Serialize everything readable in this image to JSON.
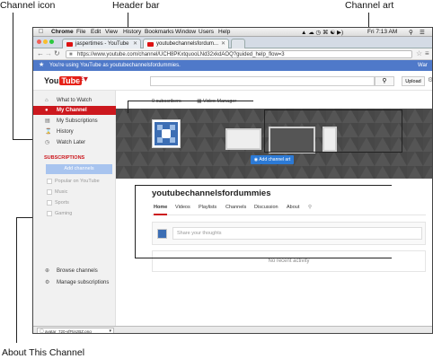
{
  "callouts": {
    "channel_icon": "Channel icon",
    "header_bar": "Header bar",
    "channel_art": "Channel art",
    "about_channel": "About This Channel"
  },
  "mac_menu": {
    "app": "Chrome",
    "items": [
      "File",
      "Edit",
      "View",
      "History",
      "Bookmarks",
      "Window",
      "Users",
      "Help"
    ],
    "clock": "Fri 7:13 AM"
  },
  "browser": {
    "tabs": [
      {
        "label": "jaspertimes - YouTube",
        "active": false
      },
      {
        "label": "youtubechannelsfordum...",
        "active": true
      }
    ],
    "url": "https://www.youtube.com/channel/UCH8PKxtquooLNd32xkdAOQ?guided_help_flow=3",
    "notice": "You're using YouTube as youtubechannelsfordummies.",
    "notice_right": "War"
  },
  "youtube": {
    "logo_you": "You",
    "logo_tube": "Tube",
    "search_icon": "search-icon",
    "upload_label": "Upload"
  },
  "sidebar": {
    "items": [
      {
        "label": "What to Watch",
        "icon": "home-icon",
        "active": false
      },
      {
        "label": "My Channel",
        "icon": "user-icon",
        "active": true
      },
      {
        "label": "My Subscriptions",
        "icon": "subscriptions-icon",
        "active": false
      },
      {
        "label": "History",
        "icon": "history-icon",
        "active": false
      },
      {
        "label": "Watch Later",
        "icon": "clock-icon",
        "active": false
      }
    ],
    "subscriptions_heading": "SUBSCRIPTIONS",
    "add_channels": "Add channels",
    "suggestions": [
      "Popular on YouTube",
      "Music",
      "Sports",
      "Gaming"
    ],
    "bottom": [
      "Browse channels",
      "Manage subscriptions"
    ]
  },
  "channel": {
    "subscribers": "0 subscribers",
    "video_manager": "Video Manager",
    "add_channel_art": "Add channel art",
    "name": "youtubechannelsfordummies",
    "tabs": [
      "Home",
      "Videos",
      "Playlists",
      "Channels",
      "Discussion",
      "About"
    ],
    "share_placeholder": "Share your thoughts",
    "no_activity": "No recent activity"
  },
  "download": {
    "file": "avatar_720-vfFtjnzBZ.png"
  },
  "colors": {
    "youtube_red": "#cc181e",
    "notice_blue": "#4f79c9",
    "art_background": "#4a4a4a",
    "avatar_blue": "#3c6eb4",
    "add_art_button": "#2c7ad6"
  }
}
